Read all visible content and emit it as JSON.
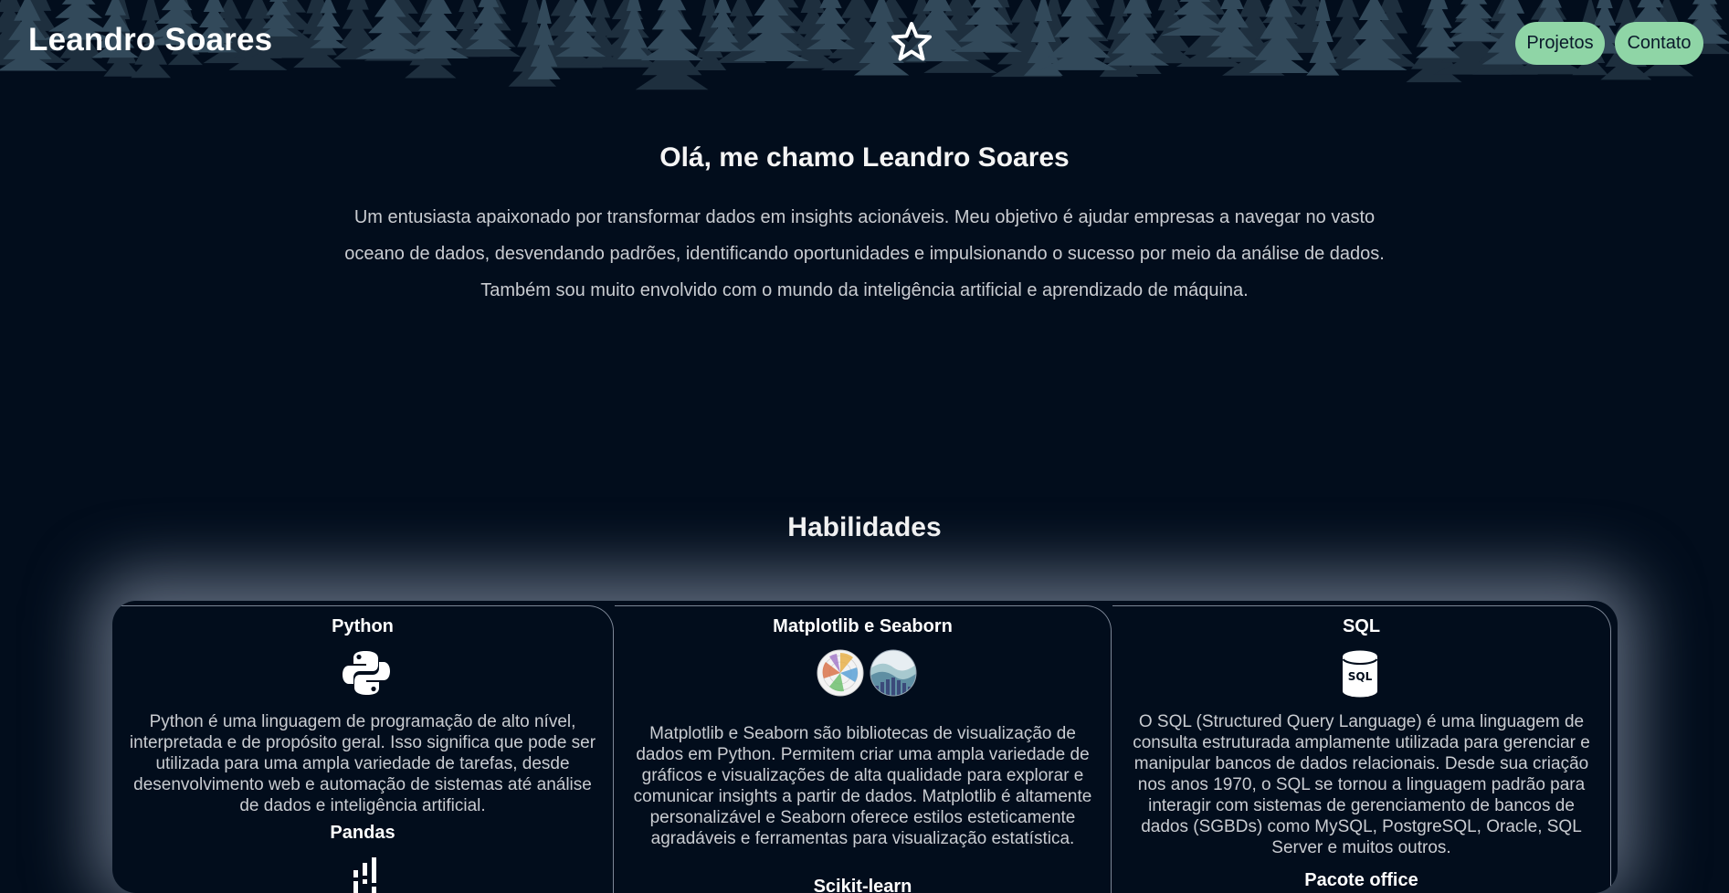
{
  "header": {
    "site_name": "Leandro Soares",
    "logo_icon": "star-outline-icon",
    "nav": [
      {
        "label": "Projetos"
      },
      {
        "label": "Contato"
      }
    ],
    "nav_button_color": "#8fd5a6"
  },
  "hero": {
    "title": "Olá, me chamo Leandro Soares",
    "lines": [
      "Um entusiasta apaixonado por transformar dados em insights acionáveis. Meu objetivo é ajudar empresas a navegar no vasto",
      "oceano de dados, desvendando padrões, identificando oportunidades e impulsionando o sucesso por meio da análise de dados.",
      "Também sou muito envolvido com o mundo da inteligência artificial e aprendizado de máquina."
    ]
  },
  "skills": {
    "title": "Habilidades",
    "cards": [
      {
        "title": "Python",
        "icon": "python-icon",
        "description": "Python é uma linguagem de programação de alto nível, interpretada e de propósito geral. Isso significa que pode ser utilizada para uma ampla variedade de tarefas, desde desenvolvimento web e automação de sistemas até análise de dados e inteligência artificial.",
        "next_title": "Pandas",
        "next_icon": "pandas-icon"
      },
      {
        "title": "Matplotlib e Seaborn",
        "icons": [
          "matplotlib-icon",
          "seaborn-icon"
        ],
        "description": "Matplotlib e Seaborn são bibliotecas de visualização de dados em Python. Permitem criar uma ampla variedade de gráficos e visualizações de alta qualidade para explorar e comunicar insights a partir de dados. Matplotlib é altamente personalizável e Seaborn oferece estilos esteticamente agradáveis e ferramentas para visualização estatística.",
        "next_title": "Scikit-learn"
      },
      {
        "title": "SQL",
        "icon": "database-sql-icon",
        "description": "O SQL (Structured Query Language) é uma linguagem de consulta estruturada amplamente utilizada para gerenciar e manipular bancos de dados relacionais. Desde sua criação nos anos 1970, o SQL se tornou a linguagem padrão para interagir com sistemas de gerenciamento de bancos de dados (SGBDs) como MySQL, PostgreSQL, Oracle, SQL Server e muitos outros.",
        "next_title": "Pacote office"
      }
    ]
  },
  "colors": {
    "background": "#020d1c",
    "text_muted": "#c9ccd1",
    "forest": "#2b3f4f"
  }
}
